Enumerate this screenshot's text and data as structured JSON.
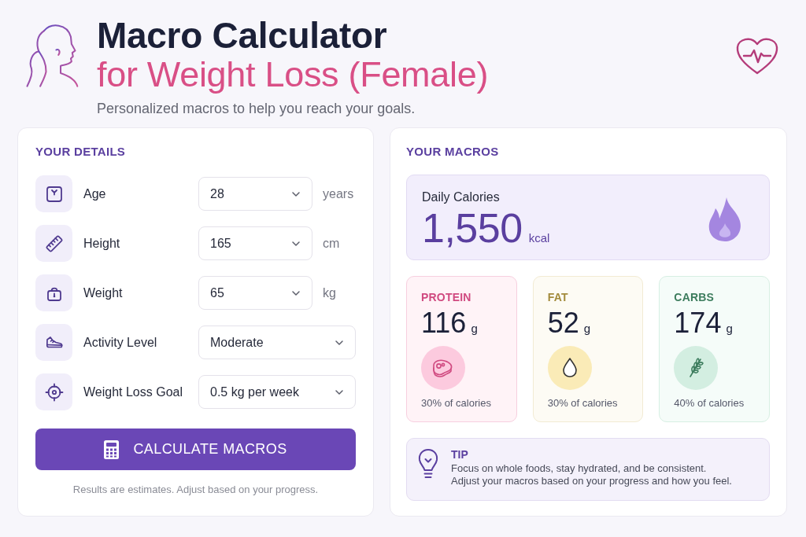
{
  "header": {
    "title": "Macro Calculator",
    "title_highlight": "for Weight Loss (Female)",
    "tagline": "Personalized macros to help you reach your goals."
  },
  "details": {
    "heading": "YOUR DETAILS",
    "fields": [
      {
        "label": "Age",
        "value": "28",
        "unit": "years"
      },
      {
        "label": "Height",
        "value": "165",
        "unit": "cm"
      },
      {
        "label": "Weight",
        "value": "65",
        "unit": "kg"
      },
      {
        "label": "Activity Level",
        "value": "Moderate"
      },
      {
        "label": "Weight Loss Goal",
        "value": "0.5 kg per week"
      }
    ],
    "button": {
      "label": "CALCULATE MACROS"
    },
    "note": "Results are estimates. Adjust based on your progress."
  },
  "macros": {
    "heading": "YOUR MACROS",
    "calories": {
      "label": "Daily Calories",
      "value": "1,550",
      "unit": "kcal"
    },
    "items": [
      {
        "name": "PROTEIN",
        "value": "116",
        "unit": "g",
        "share": "30% of calories",
        "color": "#d04a80"
      },
      {
        "name": "FAT",
        "value": "52",
        "unit": "g",
        "share": "30% of calories",
        "color": "#a38b3c"
      },
      {
        "name": "CARBS",
        "value": "174",
        "unit": "g",
        "share": "40% of calories",
        "color": "#3d7d5e"
      }
    ],
    "tip": {
      "title": "TIP",
      "lines": [
        "Focus on whole foods, stay hydrated, and be consistent.",
        "Adjust your macros based on your progress and how you feel."
      ]
    }
  }
}
